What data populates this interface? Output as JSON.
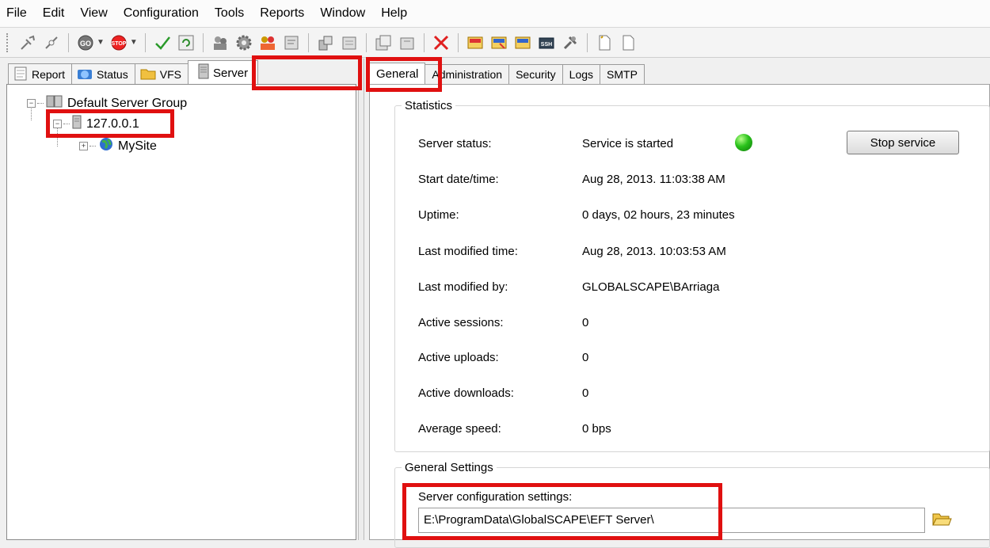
{
  "menu": [
    "File",
    "Edit",
    "View",
    "Configuration",
    "Tools",
    "Reports",
    "Window",
    "Help"
  ],
  "toolbar_icons": [
    "connect-icon",
    "disconnect-icon",
    "go-icon",
    "stop-icon",
    "apply-icon",
    "refresh-icon",
    "users-icon",
    "settings-icon",
    "groups-icon",
    "site-icon",
    "share-icon",
    "event-rule-icon",
    "event-rule-copy-icon",
    "delete-icon",
    "report-icon",
    "report-run-icon",
    "report-edit-icon",
    "ssh-icon",
    "tools-icon",
    "new-doc-icon",
    "blank-doc-icon"
  ],
  "left_tabs": [
    {
      "label": "Report",
      "icon": "report-icon"
    },
    {
      "label": "Status",
      "icon": "status-icon"
    },
    {
      "label": "VFS",
      "icon": "folder-icon"
    },
    {
      "label": "Server",
      "icon": "server-icon",
      "active": true
    }
  ],
  "tree": {
    "group": "Default Server Group",
    "server": "127.0.0.1",
    "site": "MySite"
  },
  "right_tabs": [
    "General",
    "Administration",
    "Security",
    "Logs",
    "SMTP"
  ],
  "statistics": {
    "legend": "Statistics",
    "rows": [
      {
        "label": "Server status:",
        "value": "Service is started"
      },
      {
        "label": "Start date/time:",
        "value": "Aug 28, 2013. 11:03:38 AM"
      },
      {
        "label": "Uptime:",
        "value": "0 days, 02 hours, 23 minutes"
      },
      {
        "label": "Last modified time:",
        "value": "Aug 28, 2013. 10:03:53 AM"
      },
      {
        "label": "Last modified by:",
        "value": "GLOBALSCAPE\\BArriaga"
      },
      {
        "label": "Active sessions:",
        "value": "0"
      },
      {
        "label": "Active uploads:",
        "value": "0"
      },
      {
        "label": "Active downloads:",
        "value": "0"
      },
      {
        "label": "Average speed:",
        "value": "0 bps"
      }
    ],
    "stop_button": "Stop service",
    "status_color": "#29c21b"
  },
  "general_settings": {
    "legend": "General Settings",
    "config_label": "Server configuration settings:",
    "config_path": "E:\\ProgramData\\GlobalSCAPE\\EFT Server\\"
  },
  "highlight_color": "#e01010"
}
